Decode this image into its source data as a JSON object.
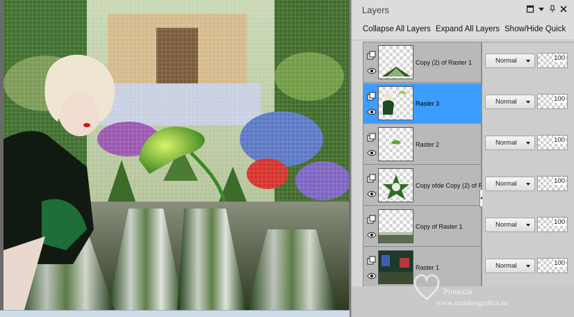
{
  "panel": {
    "title": "Layers",
    "toolbar": {
      "collapse_all": "Collapse All Layers",
      "expand_all": "Expand All Layers",
      "show_hide": "Show/Hide Quick"
    }
  },
  "layers": [
    {
      "name": "Copy (2) of Raster 1",
      "blend": "Normal",
      "opacity": "100",
      "selected": false
    },
    {
      "name": "Raster 3",
      "blend": "Normal",
      "opacity": "100",
      "selected": true
    },
    {
      "name": "Raster 2",
      "blend": "Normal",
      "opacity": "100",
      "selected": false
    },
    {
      "name": "Copy ofde Copy (2) of R",
      "blend": "Normal",
      "opacity": "100",
      "selected": false
    },
    {
      "name": "Copy of Raster 1",
      "blend": "Normal",
      "opacity": "100",
      "selected": false
    },
    {
      "name": "Raster 1",
      "blend": "Normal",
      "opacity": "100",
      "selected": false
    }
  ],
  "watermark": {
    "name": "Pinuccia",
    "url": "www.maidiregrafica.eu"
  },
  "colors": {
    "selection": "#3d9cff",
    "panel_bg": "#d7d7d7"
  }
}
